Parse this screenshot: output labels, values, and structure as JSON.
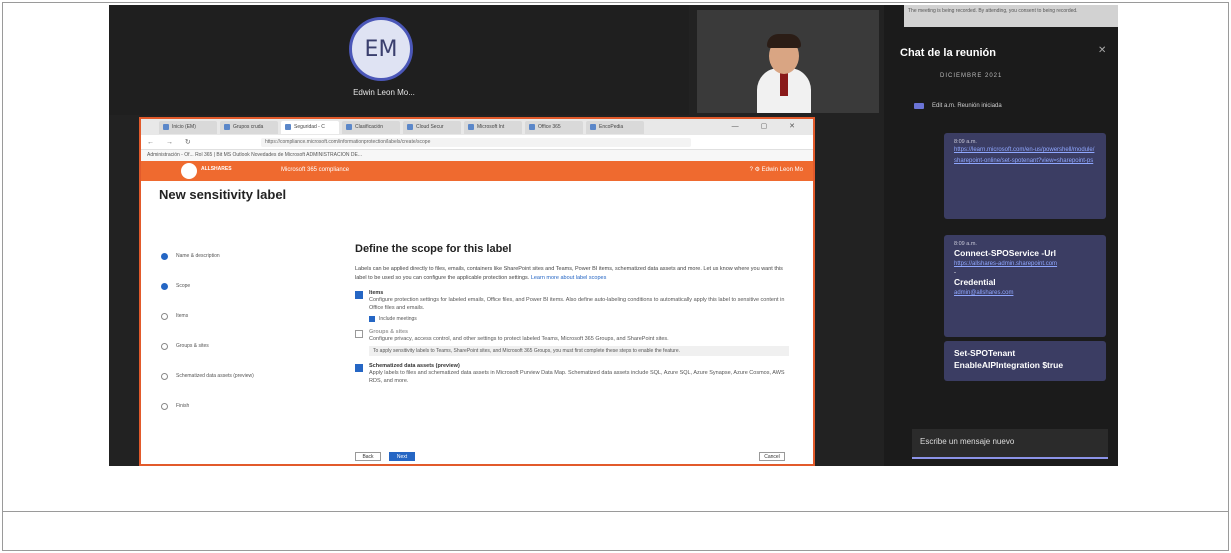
{
  "meeting": {
    "participant_initials": "EM",
    "participant_name": "Edwin Leon Mo..."
  },
  "browser": {
    "tabs": [
      {
        "label": "Inicio (EM)",
        "active": false
      },
      {
        "label": "Grupos cruda",
        "active": false
      },
      {
        "label": "Seguridad - C",
        "active": true
      },
      {
        "label": "Clasificación",
        "active": false
      },
      {
        "label": "Cloud Secur",
        "active": false
      },
      {
        "label": "Microsoft Int",
        "active": false
      },
      {
        "label": "Office 365",
        "active": false
      },
      {
        "label": "EncoPedia",
        "active": false
      }
    ],
    "window_controls": "— ▢ ✕",
    "nav": "← → ↻",
    "url": "https://compliance.microsoft.com/informationprotection/labels/create/scope",
    "bookmarks": "Administración - Of... Rol 365 | Bit MS   Outlook   Novedades de Microsoft   ADMINISTRACION DE..."
  },
  "app": {
    "logo_text": "ALLSHARES",
    "app_name": "Microsoft 365 compliance",
    "header_icons": "? ⚙ Edwin Leon Mo",
    "page_title": "New sensitivity label",
    "steps": [
      {
        "label": "Name & description",
        "done": true
      },
      {
        "label": "Scope",
        "done": true
      },
      {
        "label": "Items",
        "done": false
      },
      {
        "label": "Groups & sites",
        "done": false
      },
      {
        "label": "Schematized data assets (preview)",
        "done": false
      },
      {
        "label": "Finish",
        "done": false
      }
    ],
    "scope_title": "Define the scope for this label",
    "scope_desc": "Labels can be applied directly to files, emails, containers like SharePoint sites and Teams, Power BI items, schematized data assets and more. Let us know where you want this label to be used so you can configure the applicable protection settings.",
    "learn_more": "Learn more about label scopes",
    "options": [
      {
        "title": "Items",
        "desc": "Configure protection settings for labeled emails, Office files, and Power BI items. Also define auto-labeling conditions to automatically apply this label to sensitive content in Office files and emails.",
        "checked": true
      },
      {
        "title": "Groups & sites",
        "desc": "Configure privacy, access control, and other settings to protect labeled Teams, Microsoft 365 Groups, and SharePoint sites.",
        "checked": false
      },
      {
        "title": "Schematized data assets (preview)",
        "desc": "Apply labels to files and schematized data assets in Microsoft Purview Data Map. Schematized data assets include SQL, Azure SQL, Azure Synapse, Azure Cosmos, AWS RDS, and more.",
        "checked": true
      }
    ],
    "items_sub": "Include meetings",
    "info_note": "To apply sensitivity labels to Teams, SharePoint sites, and Microsoft 365 Groups, you must first complete these steps to enable the feature.",
    "back_label": "Back",
    "next_label": "Next",
    "cancel_label": "Cancel"
  },
  "chat": {
    "top_note": "The meeting is being recorded. By attending, you consent to being recorded.",
    "title": "Chat de la reunión",
    "date": "DICIEMBRE 2021",
    "event_text": "Edit a.m.  Reunión iniciada",
    "bubbles": [
      {
        "meta": "8:09 a.m.",
        "link": "https://learn.microsoft.com/en-us/powershell/module/sharepoint-online/set-spotenant?view=sharepoint-ps"
      },
      {
        "meta": "8:09 a.m.",
        "bold1": "Connect-SPOService -Url",
        "link1": "https://allshares-admin.sharepoint.com",
        "dash": "-",
        "bold2": "Credential",
        "link2": "admin@allshares.com"
      },
      {
        "bold": "Set-SPOTenant EnableAIPIntegration $true"
      }
    ],
    "compose_placeholder": "Escribe un mensaje nuevo"
  }
}
